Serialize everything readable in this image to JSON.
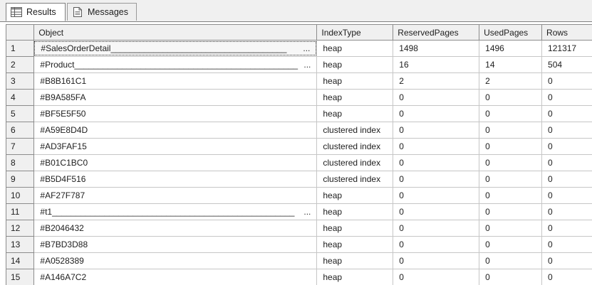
{
  "tabs": [
    {
      "label": "Results",
      "icon": "grid-icon"
    },
    {
      "label": "Messages",
      "icon": "document-icon"
    }
  ],
  "grid": {
    "columns": [
      "",
      "Object",
      "IndexType",
      "ReservedPages",
      "UsedPages",
      "Rows"
    ],
    "rows": [
      {
        "n": "1",
        "object": "#SalesOrderDetail_____________________________________",
        "more": "...",
        "type": "heap",
        "reserved": "1498",
        "used": "1496",
        "rows": "121317"
      },
      {
        "n": "2",
        "object": "#Product_______________________________________________",
        "more": "...",
        "type": "heap",
        "reserved": "16",
        "used": "14",
        "rows": "504"
      },
      {
        "n": "3",
        "object": "#B8B161C1",
        "more": "",
        "type": "heap",
        "reserved": "2",
        "used": "2",
        "rows": "0"
      },
      {
        "n": "4",
        "object": "#B9A585FA",
        "more": "",
        "type": "heap",
        "reserved": "0",
        "used": "0",
        "rows": "0"
      },
      {
        "n": "5",
        "object": "#BF5E5F50",
        "more": "",
        "type": "heap",
        "reserved": "0",
        "used": "0",
        "rows": "0"
      },
      {
        "n": "6",
        "object": "#A59E8D4D",
        "more": "",
        "type": "clustered index",
        "reserved": "0",
        "used": "0",
        "rows": "0"
      },
      {
        "n": "7",
        "object": "#AD3FAF15",
        "more": "",
        "type": "clustered index",
        "reserved": "0",
        "used": "0",
        "rows": "0"
      },
      {
        "n": "8",
        "object": "#B01C1BC0",
        "more": "",
        "type": "clustered index",
        "reserved": "0",
        "used": "0",
        "rows": "0"
      },
      {
        "n": "9",
        "object": "#B5D4F516",
        "more": "",
        "type": "clustered index",
        "reserved": "0",
        "used": "0",
        "rows": "0"
      },
      {
        "n": "10",
        "object": "#AF27F787",
        "more": "",
        "type": "heap",
        "reserved": "0",
        "used": "0",
        "rows": "0"
      },
      {
        "n": "11",
        "object": "#t1___________________________________________________",
        "more": "...",
        "type": "heap",
        "reserved": "0",
        "used": "0",
        "rows": "0"
      },
      {
        "n": "12",
        "object": "#B2046432",
        "more": "",
        "type": "heap",
        "reserved": "0",
        "used": "0",
        "rows": "0"
      },
      {
        "n": "13",
        "object": "#B7BD3D88",
        "more": "",
        "type": "heap",
        "reserved": "0",
        "used": "0",
        "rows": "0"
      },
      {
        "n": "14",
        "object": "#A0528389",
        "more": "",
        "type": "heap",
        "reserved": "0",
        "used": "0",
        "rows": "0"
      },
      {
        "n": "15",
        "object": "#A146A7C2",
        "more": "",
        "type": "heap",
        "reserved": "0",
        "used": "0",
        "rows": "0"
      }
    ]
  }
}
